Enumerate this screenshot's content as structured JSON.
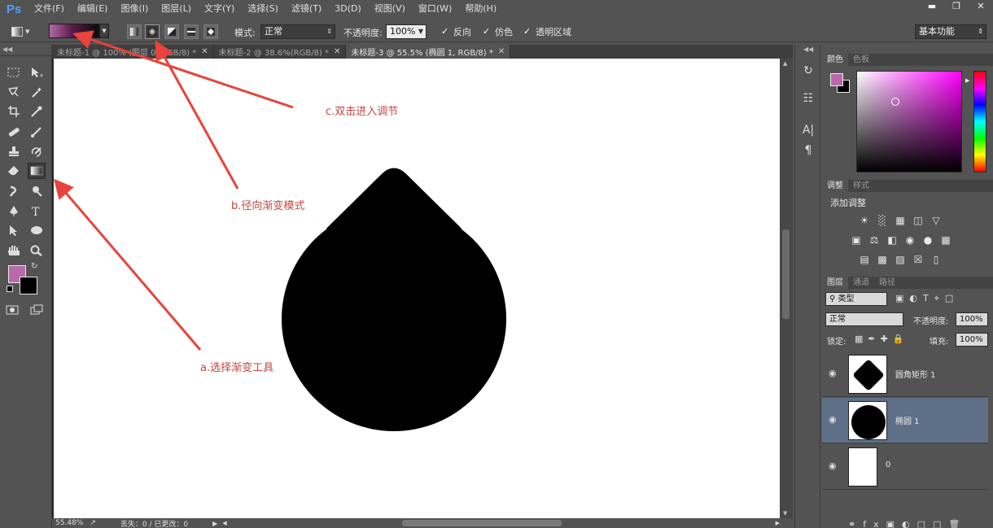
{
  "app": {
    "logo": "Ps",
    "menu": [
      "文件(F)",
      "编辑(E)",
      "图像(I)",
      "图层(L)",
      "文字(Y)",
      "选择(S)",
      "滤镜(T)",
      "3D(D)",
      "视图(V)",
      "窗口(W)",
      "帮助(H)"
    ],
    "window_controls": [
      "minimize-icon",
      "restore-icon",
      "close-icon"
    ]
  },
  "options": {
    "mode_label": "模式:",
    "mode_value": "正常",
    "opacity_label": "不透明度:",
    "opacity_value": "100%",
    "reverse": "反向",
    "dither": "仿色",
    "transparency": "透明区域",
    "workspace": "基本功能",
    "gradient_modes": [
      "linear-gradient-icon",
      "radial-gradient-icon",
      "angle-gradient-icon",
      "reflected-gradient-icon",
      "diamond-gradient-icon"
    ],
    "active_mode": "radial-gradient-icon",
    "gradient_colors": [
      "#b56aa6",
      "#000000"
    ]
  },
  "tabs": [
    {
      "label": "未标题-1 @ 100% (图层 0, RGB/8) *",
      "active": false
    },
    {
      "label": "未标题-2 @ 38.6%(RGB/8) *",
      "active": false
    },
    {
      "label": "未标题-3 @ 55.5% (椭圆 1, RGB/8) *",
      "active": true
    }
  ],
  "annotations": {
    "a": "a.选择渐变工具",
    "b": "b.径向渐变模式",
    "c": "c.双击进入调节",
    "arrow_color": "#e8433c"
  },
  "status": {
    "zoom": "55.48%",
    "info": "丢失：0 / 已更改：0"
  },
  "colors": {
    "foreground": "#b96aaa",
    "background": "#000000"
  },
  "color_panel": {
    "tabs": [
      "颜色",
      "色板"
    ]
  },
  "adjust_panel": {
    "tabs": [
      "调整",
      "样式"
    ],
    "title": "添加调整"
  },
  "layers_panel": {
    "tabs": [
      "图层",
      "通道",
      "路径"
    ],
    "filter": "类型",
    "blend": "正常",
    "opacity_label": "不透明度:",
    "opacity": "100%",
    "lock_label": "锁定:",
    "fill_label": "填充:",
    "fill": "100%",
    "layers": [
      {
        "name": "圆角矩形 1",
        "selected": false
      },
      {
        "name": "椭圆 1",
        "selected": true
      },
      {
        "name": "0",
        "selected": false
      }
    ]
  }
}
